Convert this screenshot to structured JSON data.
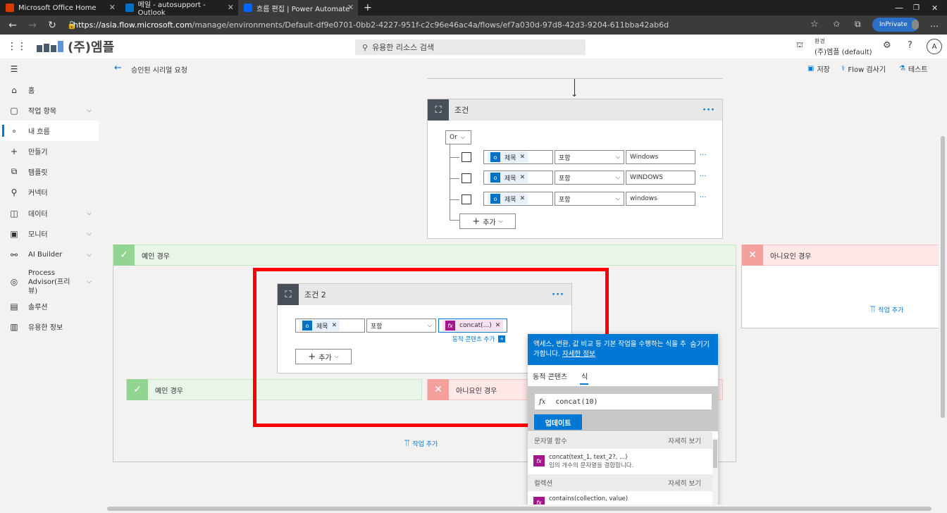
{
  "browser": {
    "tabs": [
      {
        "title": "Microsoft Office Home",
        "favicon_color": "#d83b01"
      },
      {
        "title": "메일 - autosupport - Outlook",
        "favicon_color": "#0072c6"
      },
      {
        "title": "흐름 편집 | Power Automate",
        "favicon_color": "#0066ff"
      }
    ],
    "url_host": "https://asia.flow.microsoft.com",
    "url_path": "/manage/environments/Default-df9e0701-0bb2-4227-951f-c2c96e46ac4a/flows/ef7a030d-97d8-42d3-9204-611bba42ab6d",
    "inprivate_label": "InPrivate"
  },
  "header": {
    "logo_text": "(주)엠플",
    "search_placeholder": "유용한 리소스 검색",
    "env_label": "환경",
    "env_name": "(주)엠플 (default)",
    "avatar_letter": "A"
  },
  "sidebar": {
    "items": [
      {
        "label": "홈",
        "icon": "home-icon",
        "glyph": "⌂",
        "chevron": false
      },
      {
        "label": "작업 항목",
        "icon": "clipboard-icon",
        "glyph": "▢",
        "chevron": true
      },
      {
        "label": "내 흐름",
        "icon": "flow-icon",
        "glyph": "∘",
        "chevron": false
      },
      {
        "label": "만들기",
        "icon": "plus-icon",
        "glyph": "+",
        "chevron": false
      },
      {
        "label": "템플릿",
        "icon": "template-icon",
        "glyph": "⧉",
        "chevron": false
      },
      {
        "label": "커넥터",
        "icon": "connector-icon",
        "glyph": "⚲",
        "chevron": false
      },
      {
        "label": "데이터",
        "icon": "database-icon",
        "glyph": "◫",
        "chevron": true
      },
      {
        "label": "모니터",
        "icon": "monitor-icon",
        "glyph": "▣",
        "chevron": true
      },
      {
        "label": "AI Builder",
        "icon": "ai-builder-icon",
        "glyph": "⚯",
        "chevron": true
      },
      {
        "label": "Process Advisor(프리뷰)",
        "icon": "process-advisor-icon",
        "glyph": "◎",
        "chevron": true
      },
      {
        "label": "솔루션",
        "icon": "solution-icon",
        "glyph": "▤",
        "chevron": false
      },
      {
        "label": "유용한 정보",
        "icon": "book-icon",
        "glyph": "▥",
        "chevron": false
      }
    ]
  },
  "cmdbar": {
    "flow_name": "승인된 시리얼 요청",
    "save": "저장",
    "checker": "Flow 검사기",
    "test": "테스트"
  },
  "condition1": {
    "title": "조건",
    "group_operator": "Or",
    "rows": [
      {
        "token": "제목",
        "operator": "포함",
        "value": "Windows"
      },
      {
        "token": "제목",
        "operator": "포함",
        "value": "WINDOWS"
      },
      {
        "token": "제목",
        "operator": "포함",
        "value": "windows"
      }
    ],
    "add_label": "추가"
  },
  "yes_branch": {
    "label": "예인 경우"
  },
  "no_branch": {
    "label": "아니요인 경우",
    "add_action": "작업 추가"
  },
  "condition2": {
    "title": "조건 2",
    "token": "제목",
    "operator": "포함",
    "expr_token": "concat(...)",
    "dynamic_link": "동적 콘텐츠 추가",
    "add_label": "추가",
    "yes_label": "예인 경우",
    "no_label": "아니요인 경우",
    "add_action": "작업 추가"
  },
  "panel": {
    "header_text": "액세스, 변환, 값 비교 등 기본 작업을 수행하는 식을 추가합니다.",
    "learn_more": "자세한 정보",
    "hide": "숨기기",
    "tab_dynamic": "동적 콘텐츠",
    "tab_expression": "식",
    "expression": "concat(10)",
    "update_btn": "업데이트",
    "sections": [
      {
        "title": "문자열 함수",
        "more": "자세히 보기",
        "fn": "concat(text_1, text_2?, ...)",
        "desc": "임의 개수의 문자열을 결합합니다."
      },
      {
        "title": "컬렉션",
        "more": "자세히 보기",
        "fn": "contains(collection, value)",
        "desc": ""
      }
    ]
  },
  "colors": {
    "accent": "#0078d4",
    "yes": "#92d592",
    "no": "#f4a19d",
    "highlight": "#ff0000"
  }
}
